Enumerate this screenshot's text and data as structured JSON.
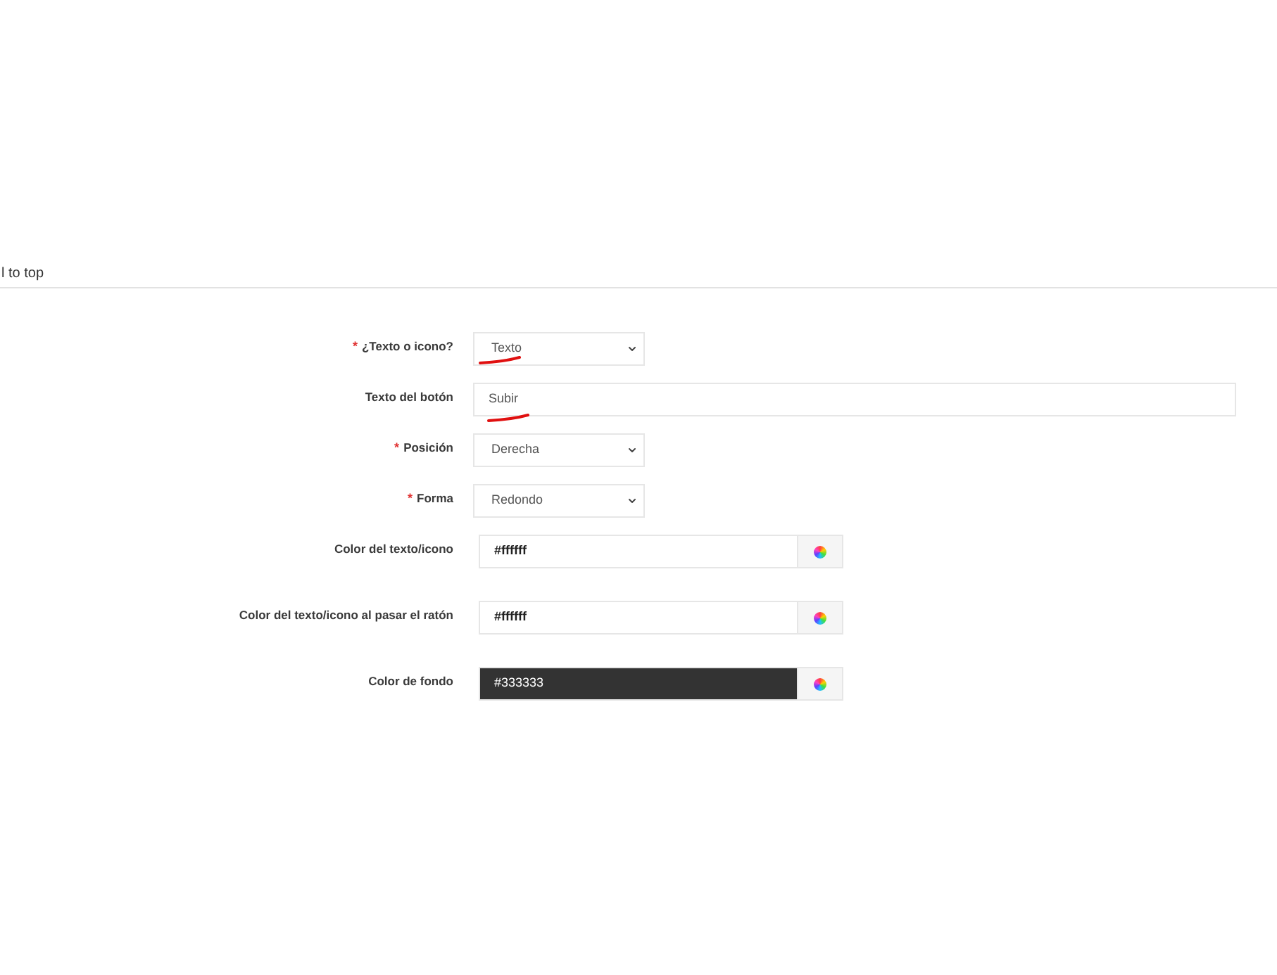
{
  "header": {
    "title": "l to top"
  },
  "fields": [
    {
      "kind": "select",
      "required_mark": "*",
      "label": "¿Texto o icono?",
      "value": "Texto",
      "annotated": true
    },
    {
      "kind": "text",
      "label": "Texto del botón",
      "value": "Subir",
      "annotated": true
    },
    {
      "kind": "select",
      "required_mark": "*",
      "label": "Posición",
      "value": "Derecha",
      "annotated": false
    },
    {
      "kind": "select",
      "required_mark": "*",
      "label": "Forma",
      "value": "Redondo",
      "annotated": false
    },
    {
      "kind": "color",
      "label": "Color del texto/icono",
      "value": "#ffffff",
      "color": "#ffffff",
      "annotated": false
    },
    {
      "kind": "color",
      "label": "Color del texto/icono al pasar el ratón",
      "value": "#ffffff",
      "color": "#ffffff",
      "annotated": false
    },
    {
      "kind": "color",
      "label": "Color de fondo",
      "value": "#333333",
      "color": "#333333",
      "annotated": false
    }
  ]
}
